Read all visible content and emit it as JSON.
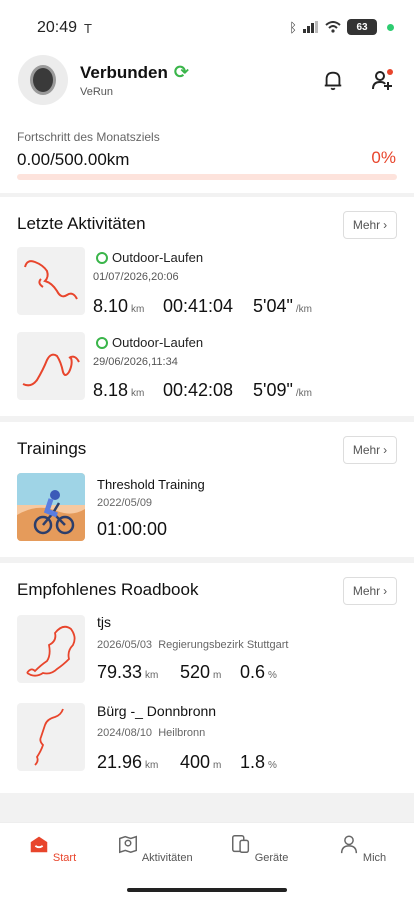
{
  "status_bar": {
    "time": "20:49",
    "battery": "63"
  },
  "device": {
    "status": "Verbunden",
    "name": "VeRun"
  },
  "goal": {
    "label": "Fortschritt des Monatsziels",
    "value": "0.00/500.00km",
    "percent_text": "0%",
    "progress": 0
  },
  "activities": {
    "title": "Letzte Aktivitäten",
    "more": "Mehr",
    "items": [
      {
        "type": "Outdoor-Laufen",
        "date": "01/07/2026,20:06",
        "distance": "8.10",
        "distance_unit": "km",
        "duration": "00:41:04",
        "pace": "5'04\"",
        "pace_unit": "/km"
      },
      {
        "type": "Outdoor-Laufen",
        "date": "29/06/2026,11:34",
        "distance": "8.18",
        "distance_unit": "km",
        "duration": "00:42:08",
        "pace": "5'09\"",
        "pace_unit": "/km"
      }
    ]
  },
  "trainings": {
    "title": "Trainings",
    "more": "Mehr",
    "item": {
      "name": "Threshold Training",
      "date": "2022/05/09",
      "duration": "01:00:00"
    }
  },
  "roadbook": {
    "title": "Empfohlenes Roadbook",
    "more": "Mehr",
    "items": [
      {
        "name": "tjs",
        "date": "2026/05/03",
        "region": "Regierungsbezirk Stuttgart",
        "distance": "79.33",
        "distance_unit": "km",
        "elevation": "520",
        "elevation_unit": "m",
        "grade": "0.6",
        "grade_unit": "%"
      },
      {
        "name": "Bürg -_ Donnbronn",
        "date": "2024/08/10",
        "region": "Heilbronn",
        "distance": "21.96",
        "distance_unit": "km",
        "elevation": "400",
        "elevation_unit": "m",
        "grade": "1.8",
        "grade_unit": "%"
      }
    ]
  },
  "tabs": [
    {
      "label": "Start",
      "icon": "home-icon",
      "active": true
    },
    {
      "label": "Aktivitäten",
      "icon": "map-pin-icon",
      "active": false
    },
    {
      "label": "Geräte",
      "icon": "devices-icon",
      "active": false
    },
    {
      "label": "Mich",
      "icon": "person-icon",
      "active": false
    }
  ],
  "colors": {
    "accent": "#e8452c",
    "success": "#3ab54a"
  }
}
